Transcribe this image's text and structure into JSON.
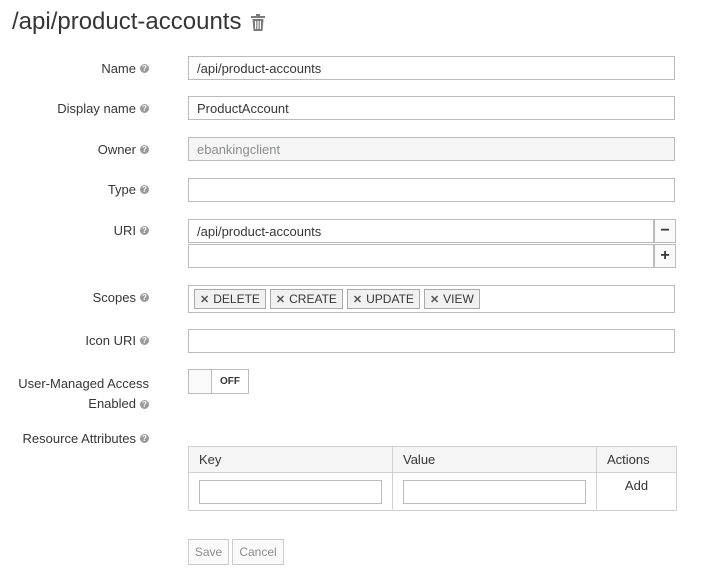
{
  "header": {
    "title": "/api/product-accounts",
    "delete_icon": "trash-icon"
  },
  "form": {
    "name": {
      "label": "Name",
      "value": "/api/product-accounts"
    },
    "display_name": {
      "label": "Display name",
      "value": "ProductAccount"
    },
    "owner": {
      "label": "Owner",
      "value": "ebankingclient"
    },
    "type": {
      "label": "Type",
      "value": ""
    },
    "uri": {
      "label": "URI",
      "values": [
        "/api/product-accounts",
        ""
      ],
      "remove_symbol": "−",
      "add_symbol": "+"
    },
    "scopes": {
      "label": "Scopes",
      "items": [
        "DELETE",
        "CREATE",
        "UPDATE",
        "VIEW"
      ]
    },
    "icon_uri": {
      "label": "Icon URI",
      "value": ""
    },
    "uma": {
      "label_line1": "User-Managed Access",
      "label_line2": "Enabled",
      "state": "OFF"
    },
    "attributes": {
      "label": "Resource Attributes",
      "headers": [
        "Key",
        "Value",
        "Actions"
      ],
      "add_label": "Add"
    }
  },
  "buttons": {
    "save": "Save",
    "cancel": "Cancel"
  }
}
